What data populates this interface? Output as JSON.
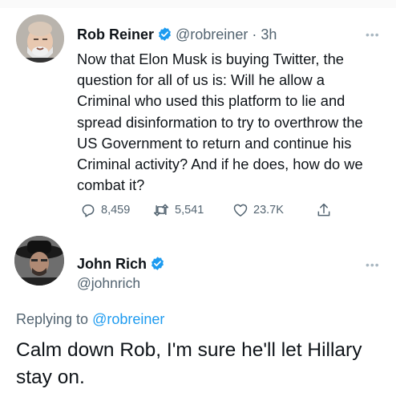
{
  "tweet1": {
    "author_name": "Rob Reiner",
    "handle": "@robreiner",
    "separator": "·",
    "time": "3h",
    "text": "Now that Elon Musk is buying Twitter, the question for all of us is: Will he allow a Criminal who used this platform to lie and spread disinformation to try to overthrow the US Government to return and continue his Criminal activity? And if he does, how do we combat it?",
    "replies": "8,459",
    "retweets": "5,541",
    "likes": "23.7K",
    "more_icon": "more-dots-icon"
  },
  "tweet2": {
    "author_name": "John Rich",
    "handle": "@johnrich",
    "replying_prefix": "Replying to",
    "replying_to": "@robreiner",
    "text": "Calm down Rob, I'm sure he'll let Hillary stay on.",
    "more_icon": "more-dots-icon"
  },
  "colors": {
    "verified": "#1d9bf0",
    "secondary_text": "#536471",
    "link": "#1d9bf0",
    "primary_text": "#0f1419"
  }
}
